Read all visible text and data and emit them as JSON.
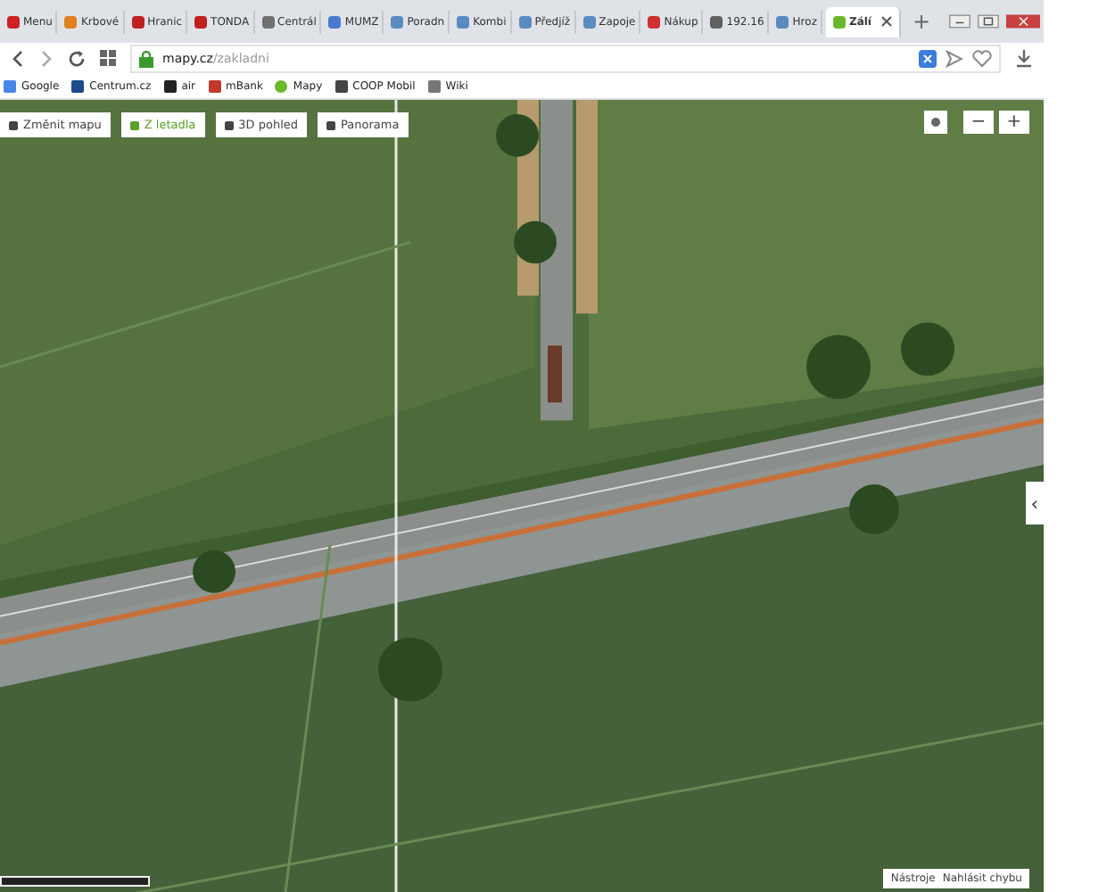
{
  "tabs": [
    {
      "label": "Menu",
      "selected": false,
      "color": "#cc2222"
    },
    {
      "label": "Krbové",
      "selected": false,
      "color": "#e08020"
    },
    {
      "label": "Hranic",
      "selected": false,
      "color": "#c02020"
    },
    {
      "label": "TONDA",
      "selected": false,
      "color": "#c02020"
    },
    {
      "label": "Centrál",
      "selected": false,
      "color": "#707070"
    },
    {
      "label": "MUMZ",
      "selected": false,
      "color": "#4a7ad0"
    },
    {
      "label": "Poradn",
      "selected": false,
      "color": "#5a8ac0"
    },
    {
      "label": "Kombi",
      "selected": false,
      "color": "#5a8ac0"
    },
    {
      "label": "Předjíž",
      "selected": false,
      "color": "#5a8ac0"
    },
    {
      "label": "Zapoje",
      "selected": false,
      "color": "#5a8ac0"
    },
    {
      "label": "Nákup",
      "selected": false,
      "color": "#d03030"
    },
    {
      "label": "192.16",
      "selected": false,
      "color": "#606060"
    },
    {
      "label": "Hroz",
      "selected": false,
      "color": "#5a8ac0"
    },
    {
      "label": "Zálí",
      "selected": true,
      "color": "#6ab82a"
    }
  ],
  "new_tab": "+",
  "address": {
    "host": "mapy.cz",
    "path": "/zakladni"
  },
  "bookmarks": [
    "Google",
    "Centrum.cz",
    "air",
    "mBank",
    "Mapy",
    "COOP Mobil",
    "Wiki"
  ],
  "map_modes": [
    {
      "label": "Změnit mapu",
      "selected": false
    },
    {
      "label": "Z letadla",
      "selected": true
    },
    {
      "label": "3D pohled",
      "selected": false
    },
    {
      "label": "Panorama",
      "selected": false
    }
  ],
  "zoom": {
    "out": "−",
    "in": "+"
  },
  "side_toggle": "‹",
  "footer_links": [
    "Nástroje",
    "Nahlásit chybu"
  ]
}
